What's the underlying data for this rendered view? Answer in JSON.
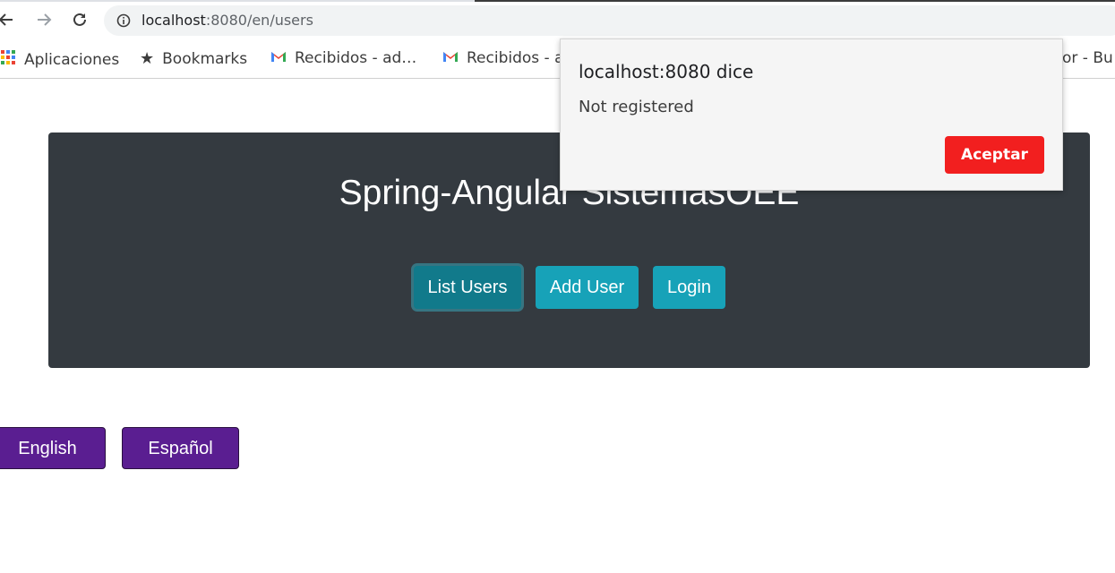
{
  "browser": {
    "url_host": "localhost",
    "url_rest": ":8080/en/users",
    "bookmarks": [
      {
        "label": "Aplicaciones",
        "icon": "apps-grid-icon"
      },
      {
        "label": "Bookmarks",
        "icon": "star-icon"
      },
      {
        "label": "Recibidos - ad…",
        "icon": "gmail-icon"
      },
      {
        "label": "Recibidos - a",
        "icon": "gmail-icon"
      },
      {
        "label": "ctor - Bu",
        "icon": ""
      }
    ]
  },
  "page": {
    "title": "Spring-Angular SistemasOEE",
    "nav": [
      "List Users",
      "Add User",
      "Login"
    ],
    "languages": [
      "English",
      "Español"
    ]
  },
  "dialog": {
    "title": "localhost:8080 dice",
    "message": "Not registered",
    "ok_label": "Aceptar"
  },
  "colors": {
    "jumbotron": "#343a40",
    "info_button": "#17a2b8",
    "language_button": "#5a1e91",
    "dialog_button": "#f21f1f"
  }
}
